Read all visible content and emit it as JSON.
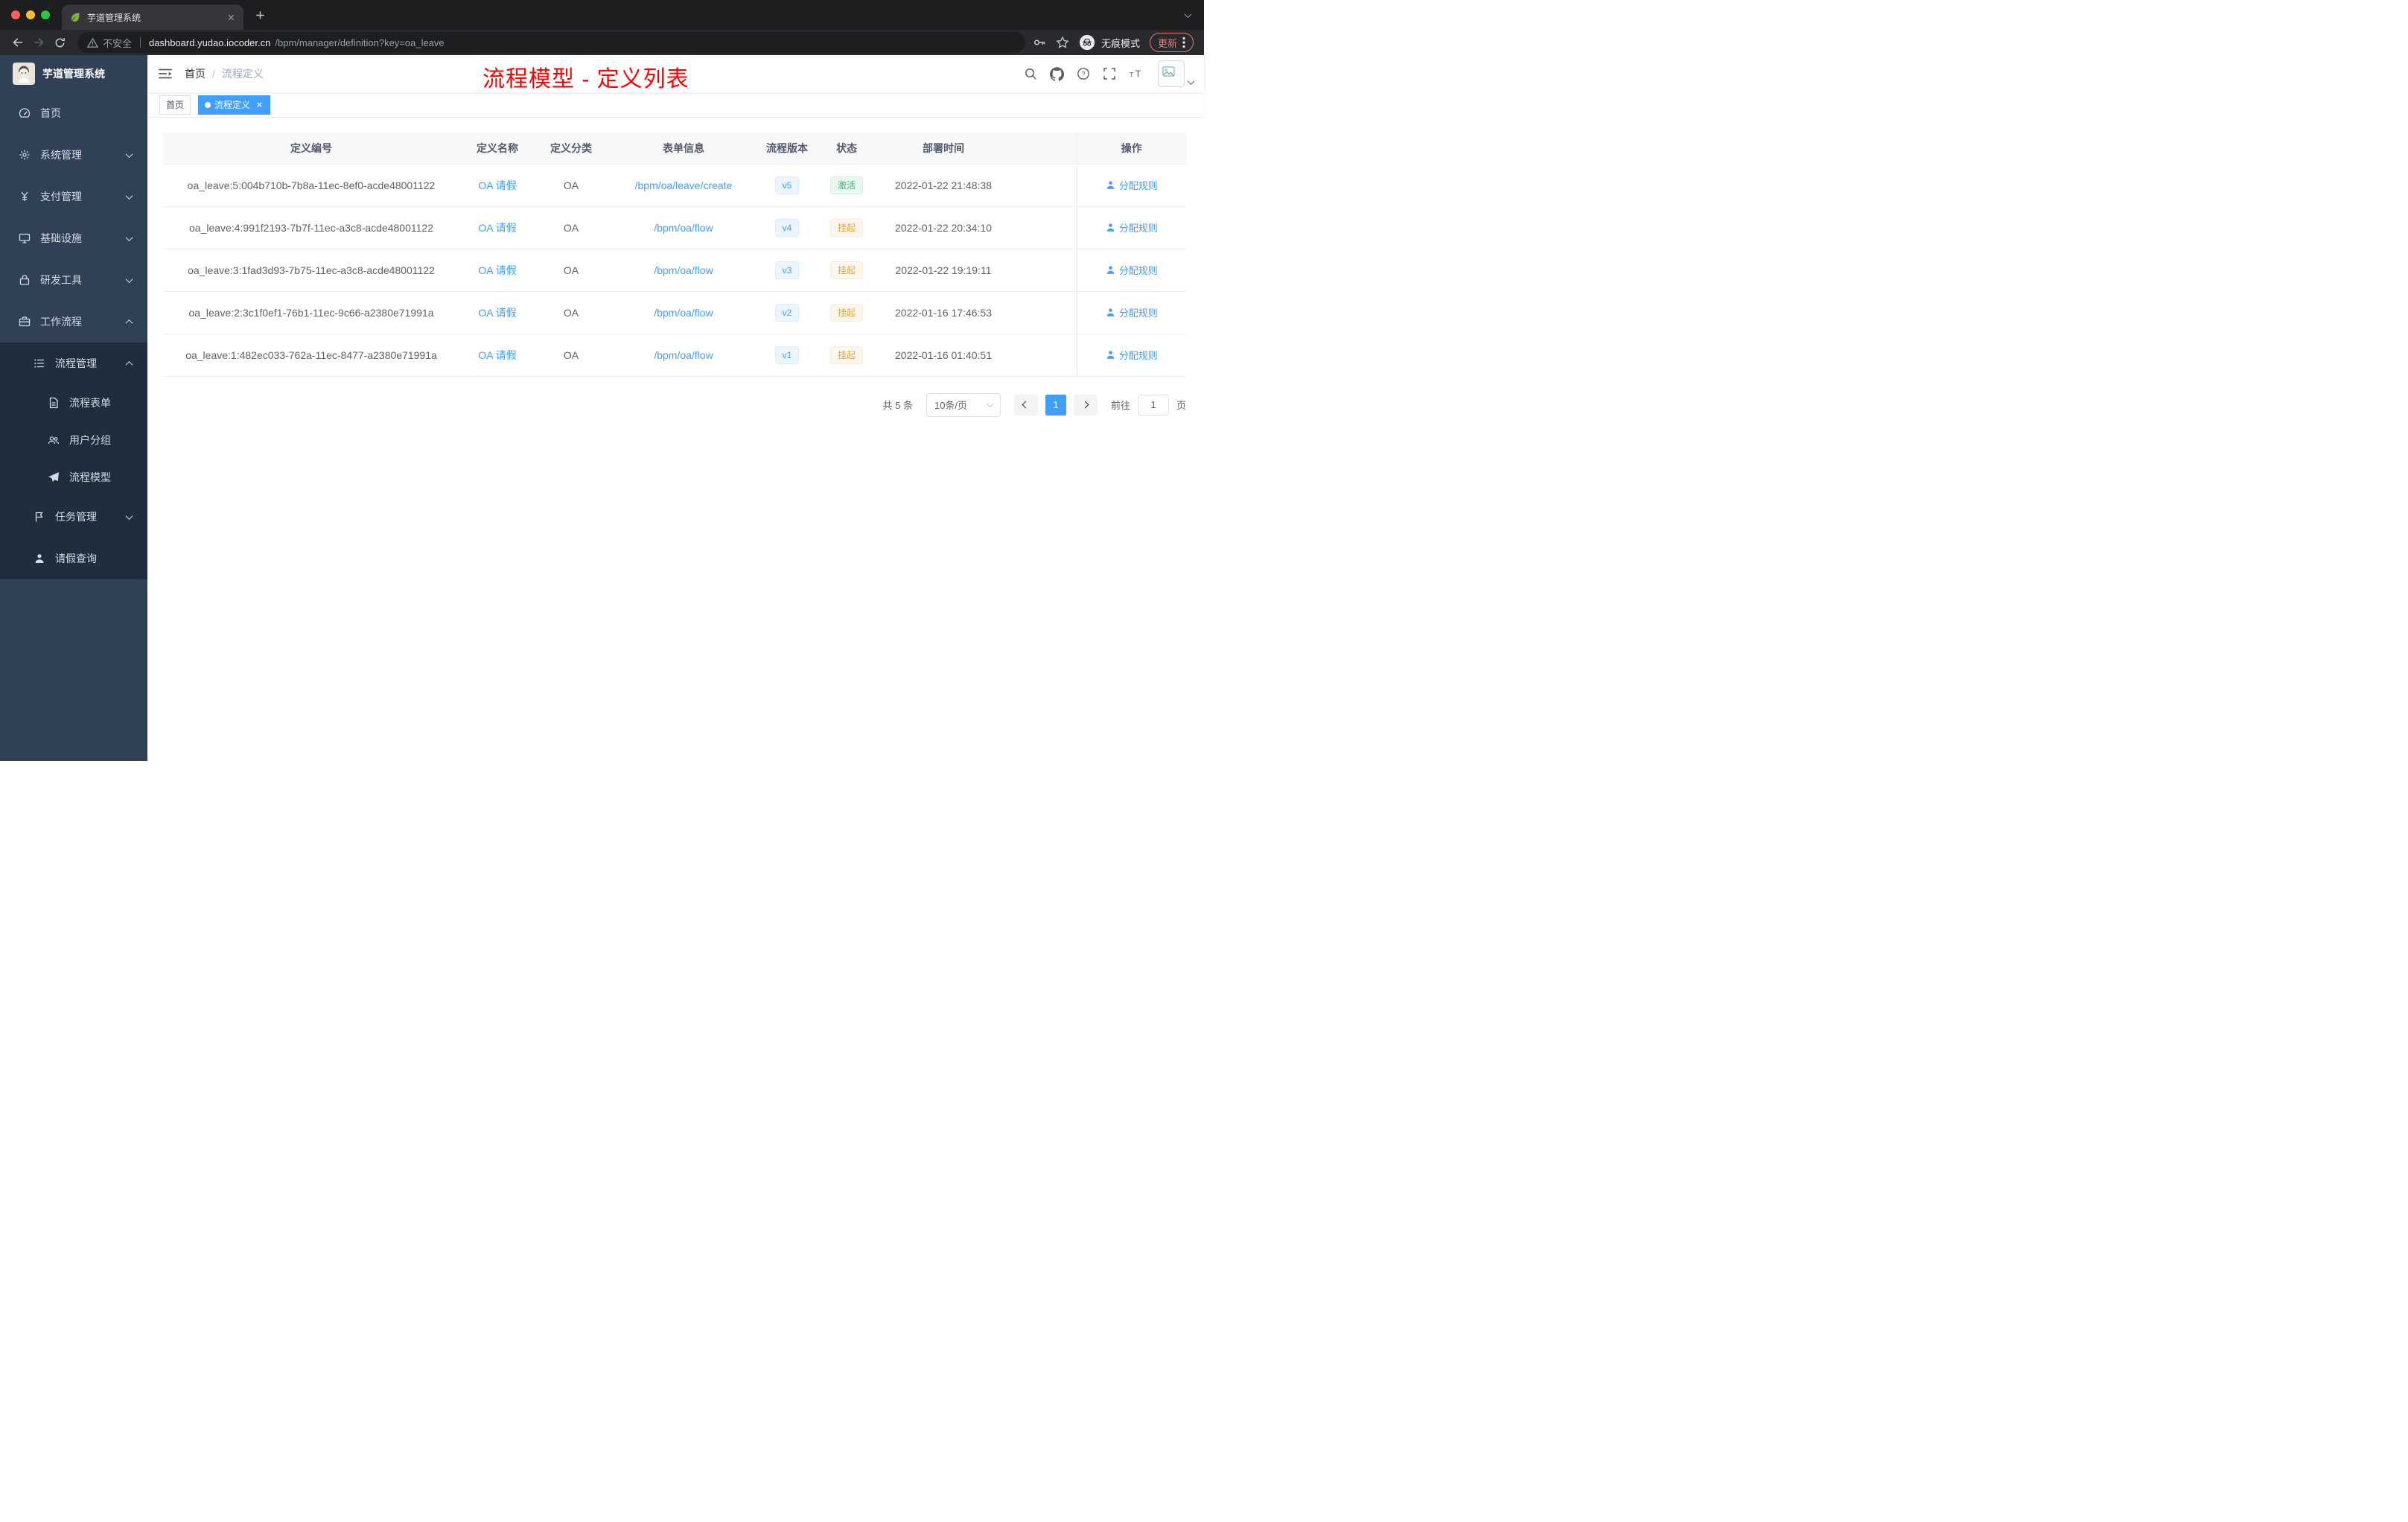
{
  "browser": {
    "tab_title": "芋道管理系统",
    "security_label": "不安全",
    "url_domain": "dashboard.yudao.iocoder.cn",
    "url_path": "/bpm/manager/definition?key=oa_leave",
    "incognito_label": "无痕模式",
    "update_label": "更新"
  },
  "sidebar": {
    "logo_title": "芋道管理系统",
    "items": {
      "home": "首页",
      "system": "系统管理",
      "payment": "支付管理",
      "infra": "基础设施",
      "devtools": "研发工具",
      "workflow": "工作流程",
      "process_mgmt": "流程管理",
      "process_form": "流程表单",
      "user_group": "用户分组",
      "process_model": "流程模型",
      "task_mgmt": "任务管理",
      "leave_query": "请假查询"
    }
  },
  "header": {
    "breadcrumb_home": "首页",
    "breadcrumb_separator": "/",
    "breadcrumb_current": "流程定义",
    "annotation": "流程模型 - 定义列表"
  },
  "tags": {
    "home": "首页",
    "current": "流程定义"
  },
  "table": {
    "columns": [
      "定义编号",
      "定义名称",
      "定义分类",
      "表单信息",
      "流程版本",
      "状态",
      "部署时间",
      "操作"
    ],
    "rows": [
      {
        "id": "oa_leave:5:004b710b-7b8a-11ec-8ef0-acde48001122",
        "name": "OA 请假",
        "category": "OA",
        "form": "/bpm/oa/leave/create",
        "version": "v5",
        "status": "激活",
        "status_type": "success",
        "time": "2022-01-22 21:48:38",
        "action": "分配规则"
      },
      {
        "id": "oa_leave:4:991f2193-7b7f-11ec-a3c8-acde48001122",
        "name": "OA 请假",
        "category": "OA",
        "form": "/bpm/oa/flow",
        "version": "v4",
        "status": "挂起",
        "status_type": "warning",
        "time": "2022-01-22 20:34:10",
        "action": "分配规则"
      },
      {
        "id": "oa_leave:3:1fad3d93-7b75-11ec-a3c8-acde48001122",
        "name": "OA 请假",
        "category": "OA",
        "form": "/bpm/oa/flow",
        "version": "v3",
        "status": "挂起",
        "status_type": "warning",
        "time": "2022-01-22 19:19:11",
        "action": "分配规则"
      },
      {
        "id": "oa_leave:2:3c1f0ef1-76b1-11ec-9c66-a2380e71991a",
        "name": "OA 请假",
        "category": "OA",
        "form": "/bpm/oa/flow",
        "version": "v2",
        "status": "挂起",
        "status_type": "warning",
        "time": "2022-01-16 17:46:53",
        "action": "分配规则"
      },
      {
        "id": "oa_leave:1:482ec033-762a-11ec-8477-a2380e71991a",
        "name": "OA 请假",
        "category": "OA",
        "form": "/bpm/oa/flow",
        "version": "v1",
        "status": "挂起",
        "status_type": "warning",
        "time": "2022-01-16 01:40:51",
        "action": "分配规则"
      }
    ]
  },
  "pagination": {
    "total": "共 5 条",
    "page_size": "10条/页",
    "current_page": "1",
    "goto_label": "前往",
    "goto_value": "1",
    "page_unit": "页"
  }
}
